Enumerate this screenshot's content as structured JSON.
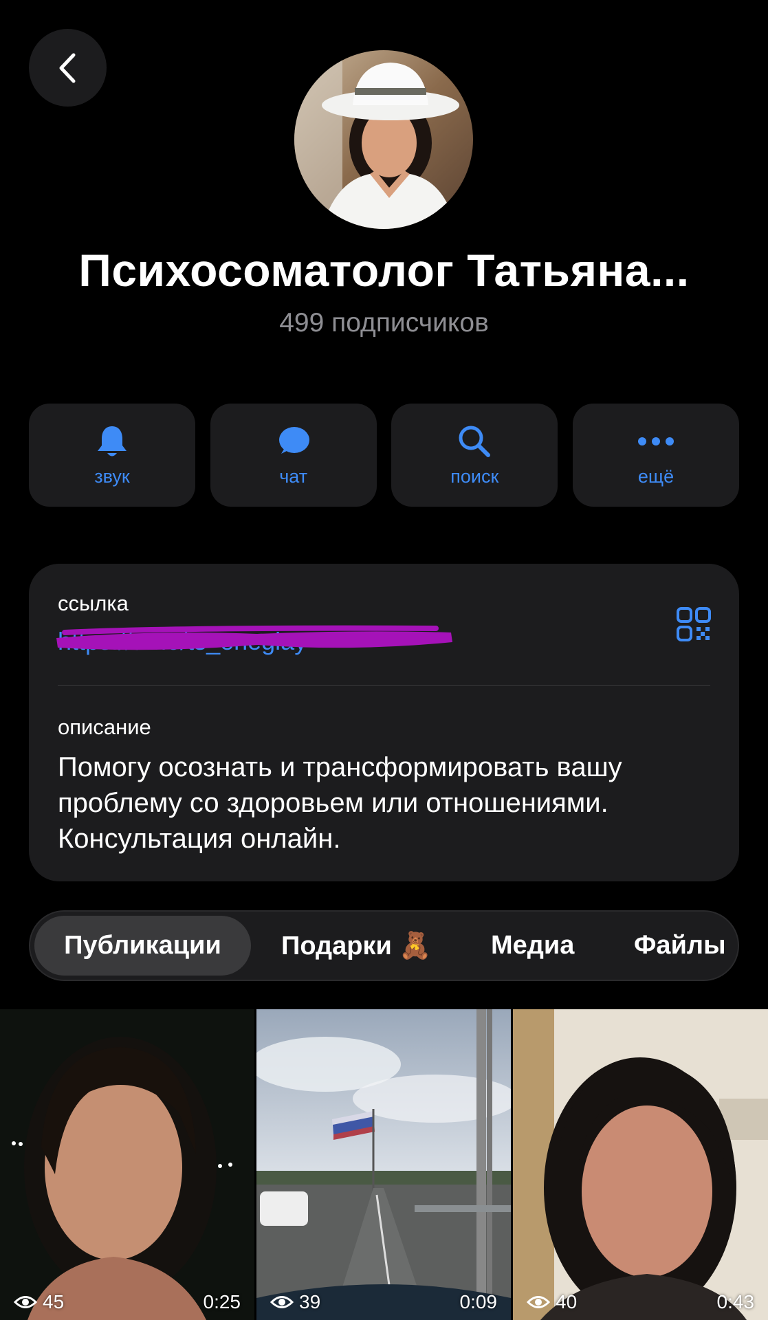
{
  "channel": {
    "title": "Психосоматолог Татьяна...",
    "subscribers": "499 подписчиков"
  },
  "actions": [
    {
      "label": "звук",
      "icon": "bell-icon"
    },
    {
      "label": "чат",
      "icon": "chat-bubble-icon"
    },
    {
      "label": "поиск",
      "icon": "search-icon"
    },
    {
      "label": "ещё",
      "icon": "more-dots-icon"
    }
  ],
  "info": {
    "link_label": "ссылка",
    "link_value": "https://t.me/ts_enegiay",
    "description_label": "описание",
    "description_text": "Помогу осознать и трансформировать  вашу проблему со здоровьем или отношениями. Консультация онлайн."
  },
  "tabs": [
    {
      "label": "Публикации",
      "active": true
    },
    {
      "label": "Подарки 🧸",
      "active": false
    },
    {
      "label": "Медиа",
      "active": false
    },
    {
      "label": "Файлы",
      "active": false
    }
  ],
  "posts": [
    {
      "views": "45",
      "duration": "0:25"
    },
    {
      "views": "39",
      "duration": "0:09"
    },
    {
      "views": "40",
      "duration": "0:43"
    }
  ],
  "colors": {
    "accent": "#3e8bf6",
    "card_bg": "#1c1c1e",
    "redaction": "#a512b8"
  }
}
